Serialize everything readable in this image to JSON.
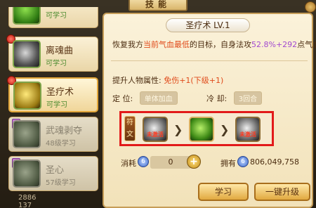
{
  "header": {
    "title": "技能"
  },
  "skills": [
    {
      "name": "",
      "sub": "可学习",
      "state": "available",
      "icon": "skill-leaf-icon",
      "red_dot": false
    },
    {
      "name": "离魂曲",
      "sub": "可学习",
      "state": "available",
      "icon": "skill-music-icon",
      "red_dot": true
    },
    {
      "name": "圣疗术",
      "sub": "可学习",
      "state": "selected",
      "icon": "skill-heal-icon",
      "red_dot": true
    },
    {
      "name": "武魂剥夺",
      "sub": "48级学习",
      "state": "locked",
      "icon": "skill-shadow-icon",
      "red_dot": false
    },
    {
      "name": "圣心",
      "sub": "57级学习",
      "state": "locked",
      "icon": "skill-heart-icon",
      "red_dot": false
    }
  ],
  "score": {
    "line1": "2886",
    "line2": "137"
  },
  "detail": {
    "title": "圣疗术 LV.1",
    "desc_pre": "恢复我方",
    "desc_target": "当前气血最低",
    "desc_mid": "的目标，自身法攻",
    "desc_percent": "52.8%+292",
    "desc_post": "点气血",
    "attr_label": "提升人物属性:",
    "attr_value": "免伤+1(下级+1)",
    "position_label": "定 位:",
    "position_value": "单体加血",
    "cooldown_label": "冷 却:",
    "cooldown_value": "3回合"
  },
  "runes": {
    "tag": "符文",
    "slots": [
      {
        "label": "未激活",
        "icon": "rune-locked-icon"
      },
      {
        "label": "",
        "icon": "rune-active-icon"
      },
      {
        "label": "未激活",
        "icon": "rune-locked-icon"
      }
    ]
  },
  "cost": {
    "label": "消耗",
    "value": "0",
    "own_label": "拥有",
    "own_value": "806,049,758",
    "currency_icon": "coin-icon"
  },
  "buttons": {
    "learn": "学习",
    "upgrade": "一键升级"
  }
}
